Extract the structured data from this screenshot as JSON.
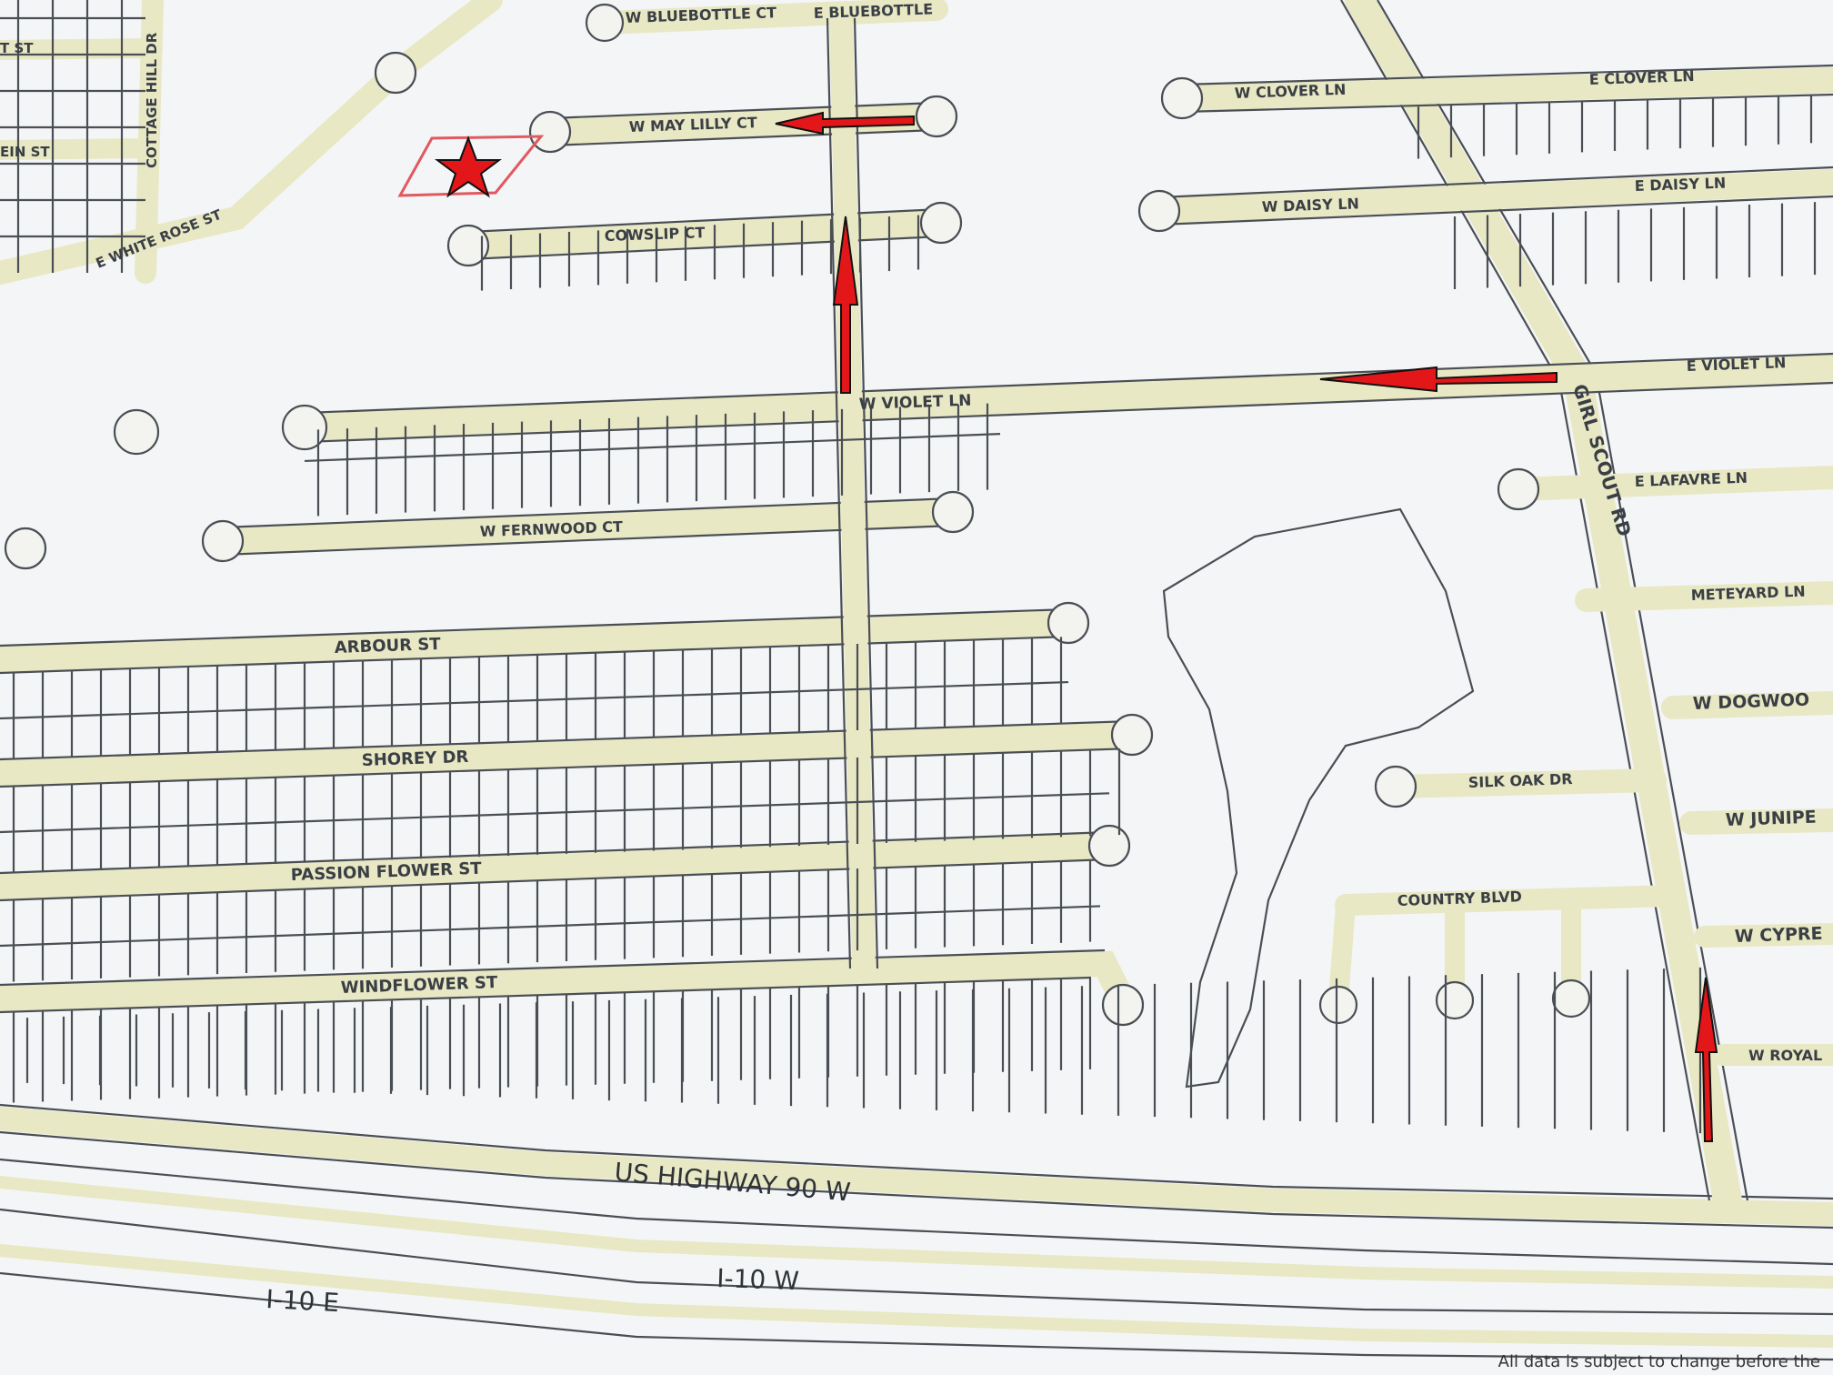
{
  "colors": {
    "background": "#f4f5f7",
    "road_fill": "#e9e8c4",
    "parcel_line": "#4a4f55",
    "highlight_parcel": "#e05a60",
    "marker": "#e3161a"
  },
  "streets": {
    "bluebottle_w": "W BLUEBOTTLE CT",
    "bluebottle_e": "E BLUEBOTTLE",
    "cottage_hill": "COTTAGE HILL DR",
    "st_left_top": "T ST",
    "st_left_mid": "EIN ST",
    "white_rose": "E WHITE ROSE ST",
    "may_lilly": "W MAY LILLY CT",
    "cowslip": "COWSLIP CT",
    "clover_w": "W CLOVER LN",
    "clover_e": "E CLOVER LN",
    "daisy_w": "W DAISY LN",
    "daisy_e": "E DAISY LN",
    "violet_w": "W VIOLET LN",
    "violet_e": "E VIOLET LN",
    "girl_scout": "GIRL SCOUT RD",
    "lafavre": "E LAFAVRE LN",
    "meteyard": "METEYARD LN",
    "dogwood": "W DOGWOO",
    "juniper": "W JUNIPE",
    "cypress": "W CYPRE",
    "royal": "W ROYAL",
    "fernwood": "W FERNWOOD CT",
    "arbour": "ARBOUR ST",
    "shorey": "SHOREY DR",
    "passion_flower": "PASSION FLOWER ST",
    "windflower": "WINDFLOWER ST",
    "silk_oak": "SILK OAK DR",
    "country_blvd": "COUNTRY BLVD",
    "us90": "US HIGHWAY 90 W",
    "i10w": "I-10 W",
    "i10e": "I-10 E"
  },
  "disclaimer": "All data is subject to change before the",
  "markers": {
    "star_icon": "star-icon",
    "arrow_icon": "arrow-icon"
  }
}
